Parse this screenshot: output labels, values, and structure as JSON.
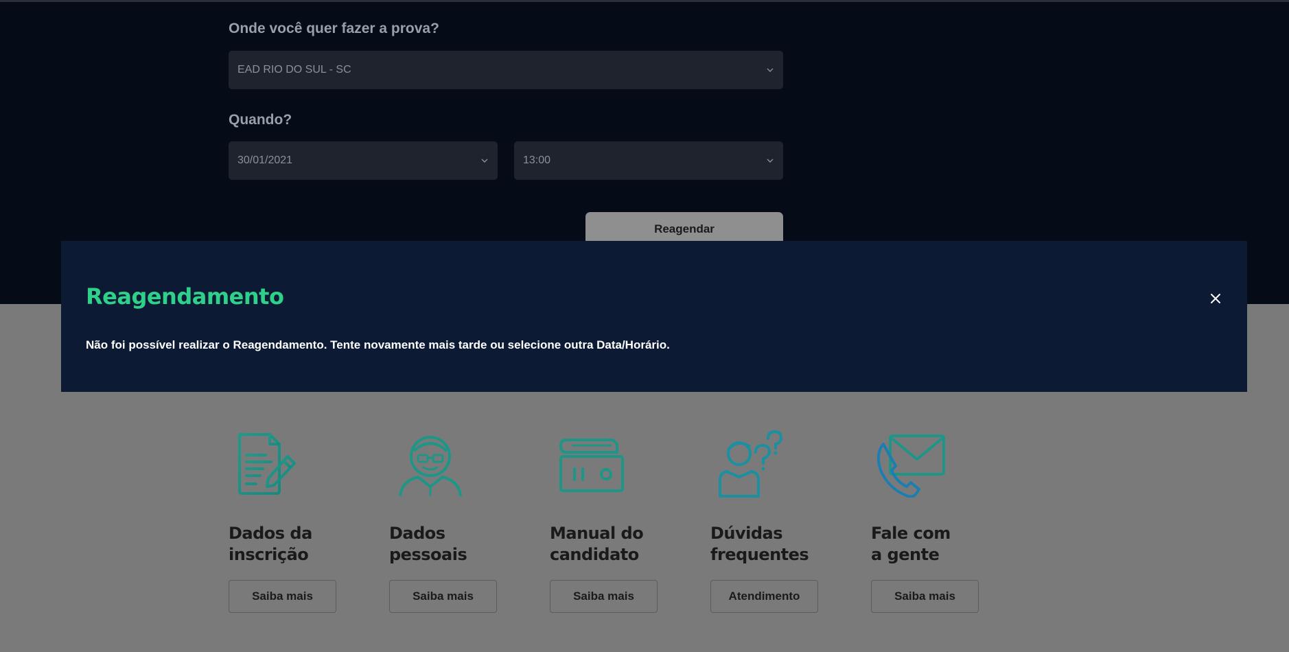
{
  "form": {
    "question_local": "Onde você quer fazer a prova?",
    "local_value": "EAD RIO DO SUL - SC",
    "question_when": "Quando?",
    "date_value": "30/01/2021",
    "time_value": "13:00",
    "reagendar_label": "Reagendar"
  },
  "modal": {
    "title": "Reagendamento",
    "message": "Não foi possível realizar o Reagendamento. Tente novamente mais tarde ou selecione outra Data/Horário."
  },
  "cards": [
    {
      "title": "Dados da\ninscrição",
      "button": "Saiba mais",
      "icon": "document-pen-icon"
    },
    {
      "title": "Dados\npessoais",
      "button": "Saiba mais",
      "icon": "person-glasses-icon"
    },
    {
      "title": "Manual do\ncandidato",
      "button": "Saiba mais",
      "icon": "book-icon"
    },
    {
      "title": "Dúvidas\nfrequentes",
      "button": "Atendimento",
      "icon": "person-question-icon"
    },
    {
      "title": "Fale com\na gente",
      "button": "Saiba mais",
      "icon": "phone-envelope-icon"
    }
  ],
  "colors": {
    "accent_green": "#2fd08a",
    "icon_teal": "#1f8f85",
    "modal_bg": "#0c1a34",
    "top_bg": "#060c17",
    "overlay_bg": "#7a7a7a"
  }
}
